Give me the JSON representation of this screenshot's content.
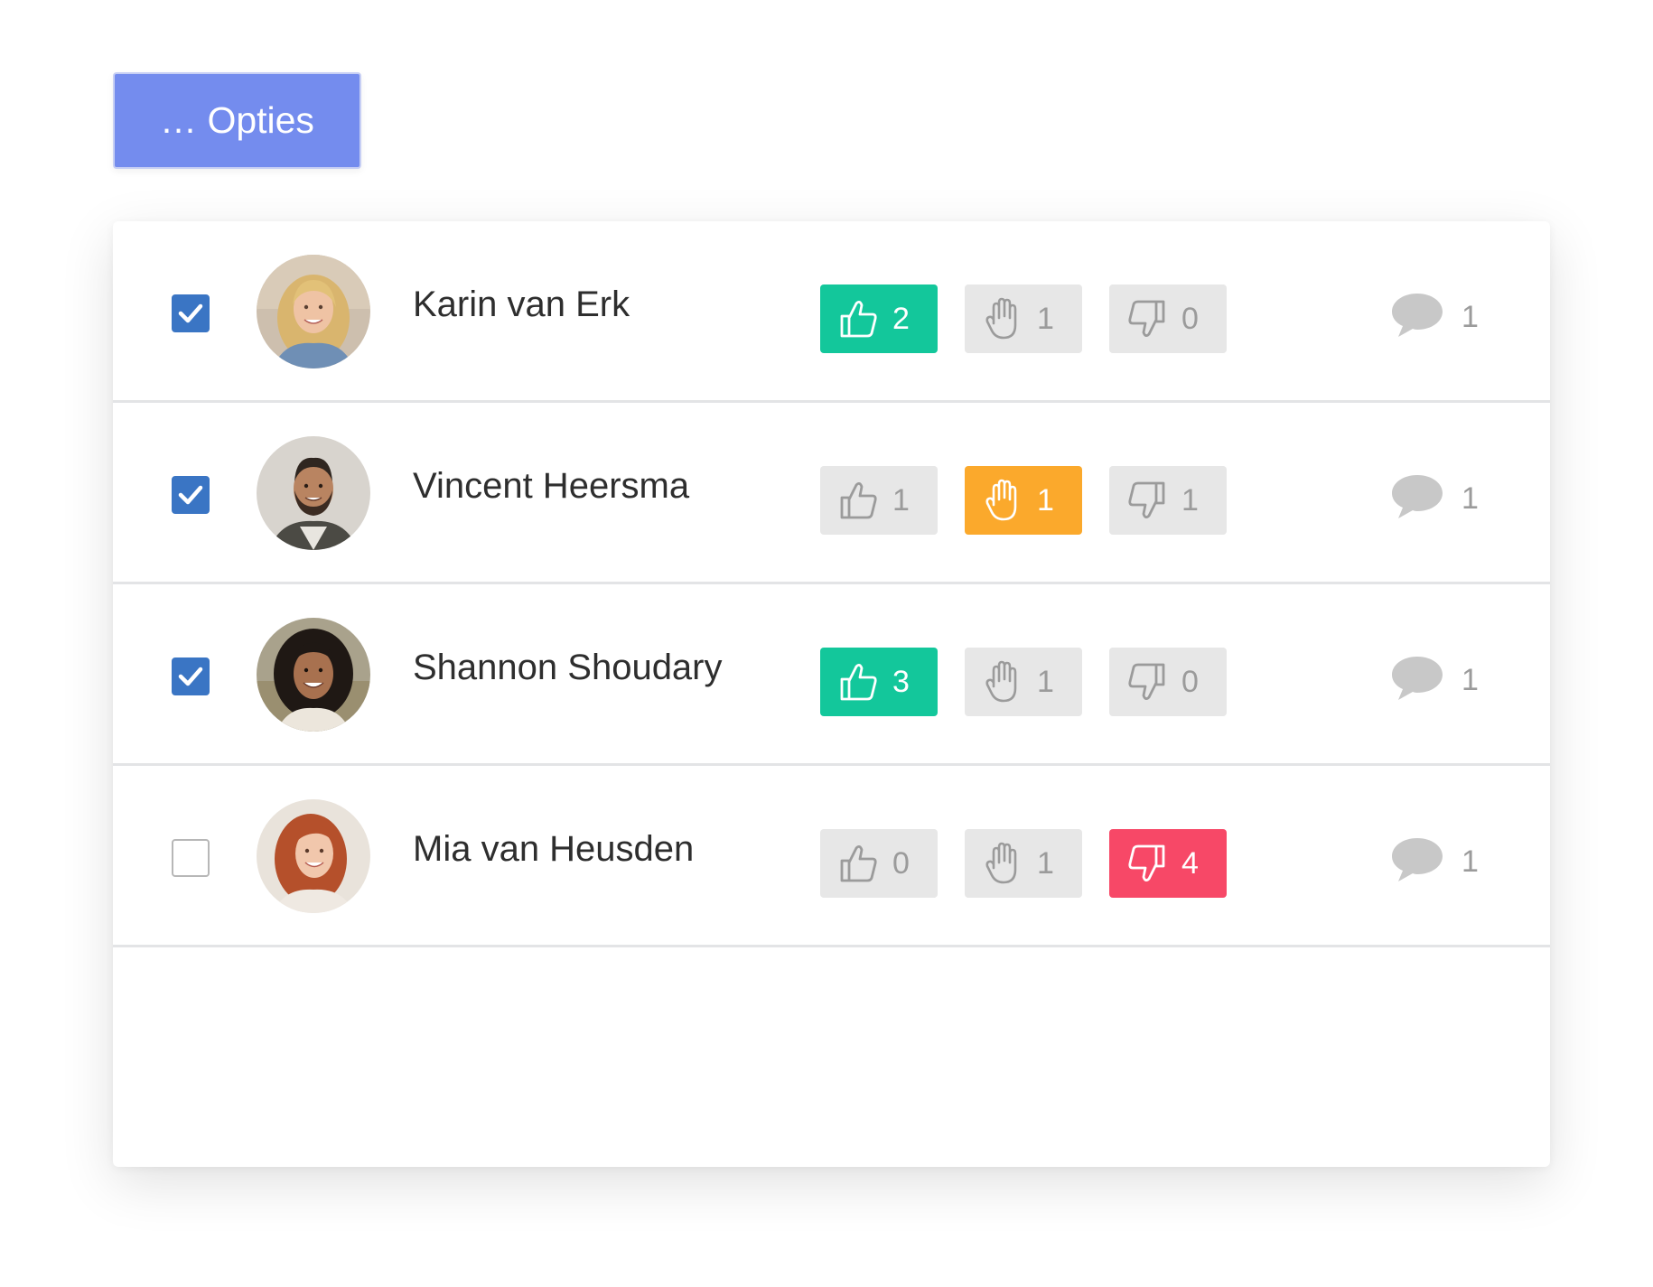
{
  "toolbar": {
    "options_label": "… Opties"
  },
  "colors": {
    "accent": "#748cee",
    "checkbox_checked": "#3a75c4",
    "vote_up_active": "#13c79b",
    "vote_hand_active": "#fba92c",
    "vote_down_active": "#f74867",
    "vote_inactive_bg": "#e7e7e7",
    "vote_inactive_fg": "#9b9b9b",
    "comment_icon": "#c8c8c8"
  },
  "people": [
    {
      "name": "Karin van Erk",
      "checked": true,
      "avatar": "woman-blonde-avatar",
      "votes": {
        "up": "2",
        "hand": "1",
        "down": "0"
      },
      "active_vote": "up",
      "comments": "1"
    },
    {
      "name": "Vincent Heersma",
      "checked": true,
      "avatar": "man-beard-avatar",
      "votes": {
        "up": "1",
        "hand": "1",
        "down": "1"
      },
      "active_vote": "hand",
      "comments": "1"
    },
    {
      "name": "Shannon Shoudary",
      "checked": true,
      "avatar": "woman-curly-avatar",
      "votes": {
        "up": "3",
        "hand": "1",
        "down": "0"
      },
      "active_vote": "up",
      "comments": "1"
    },
    {
      "name": "Mia van Heusden",
      "checked": false,
      "avatar": "woman-redhead-avatar",
      "votes": {
        "up": "0",
        "hand": "1",
        "down": "4"
      },
      "active_vote": "down",
      "comments": "1"
    }
  ]
}
